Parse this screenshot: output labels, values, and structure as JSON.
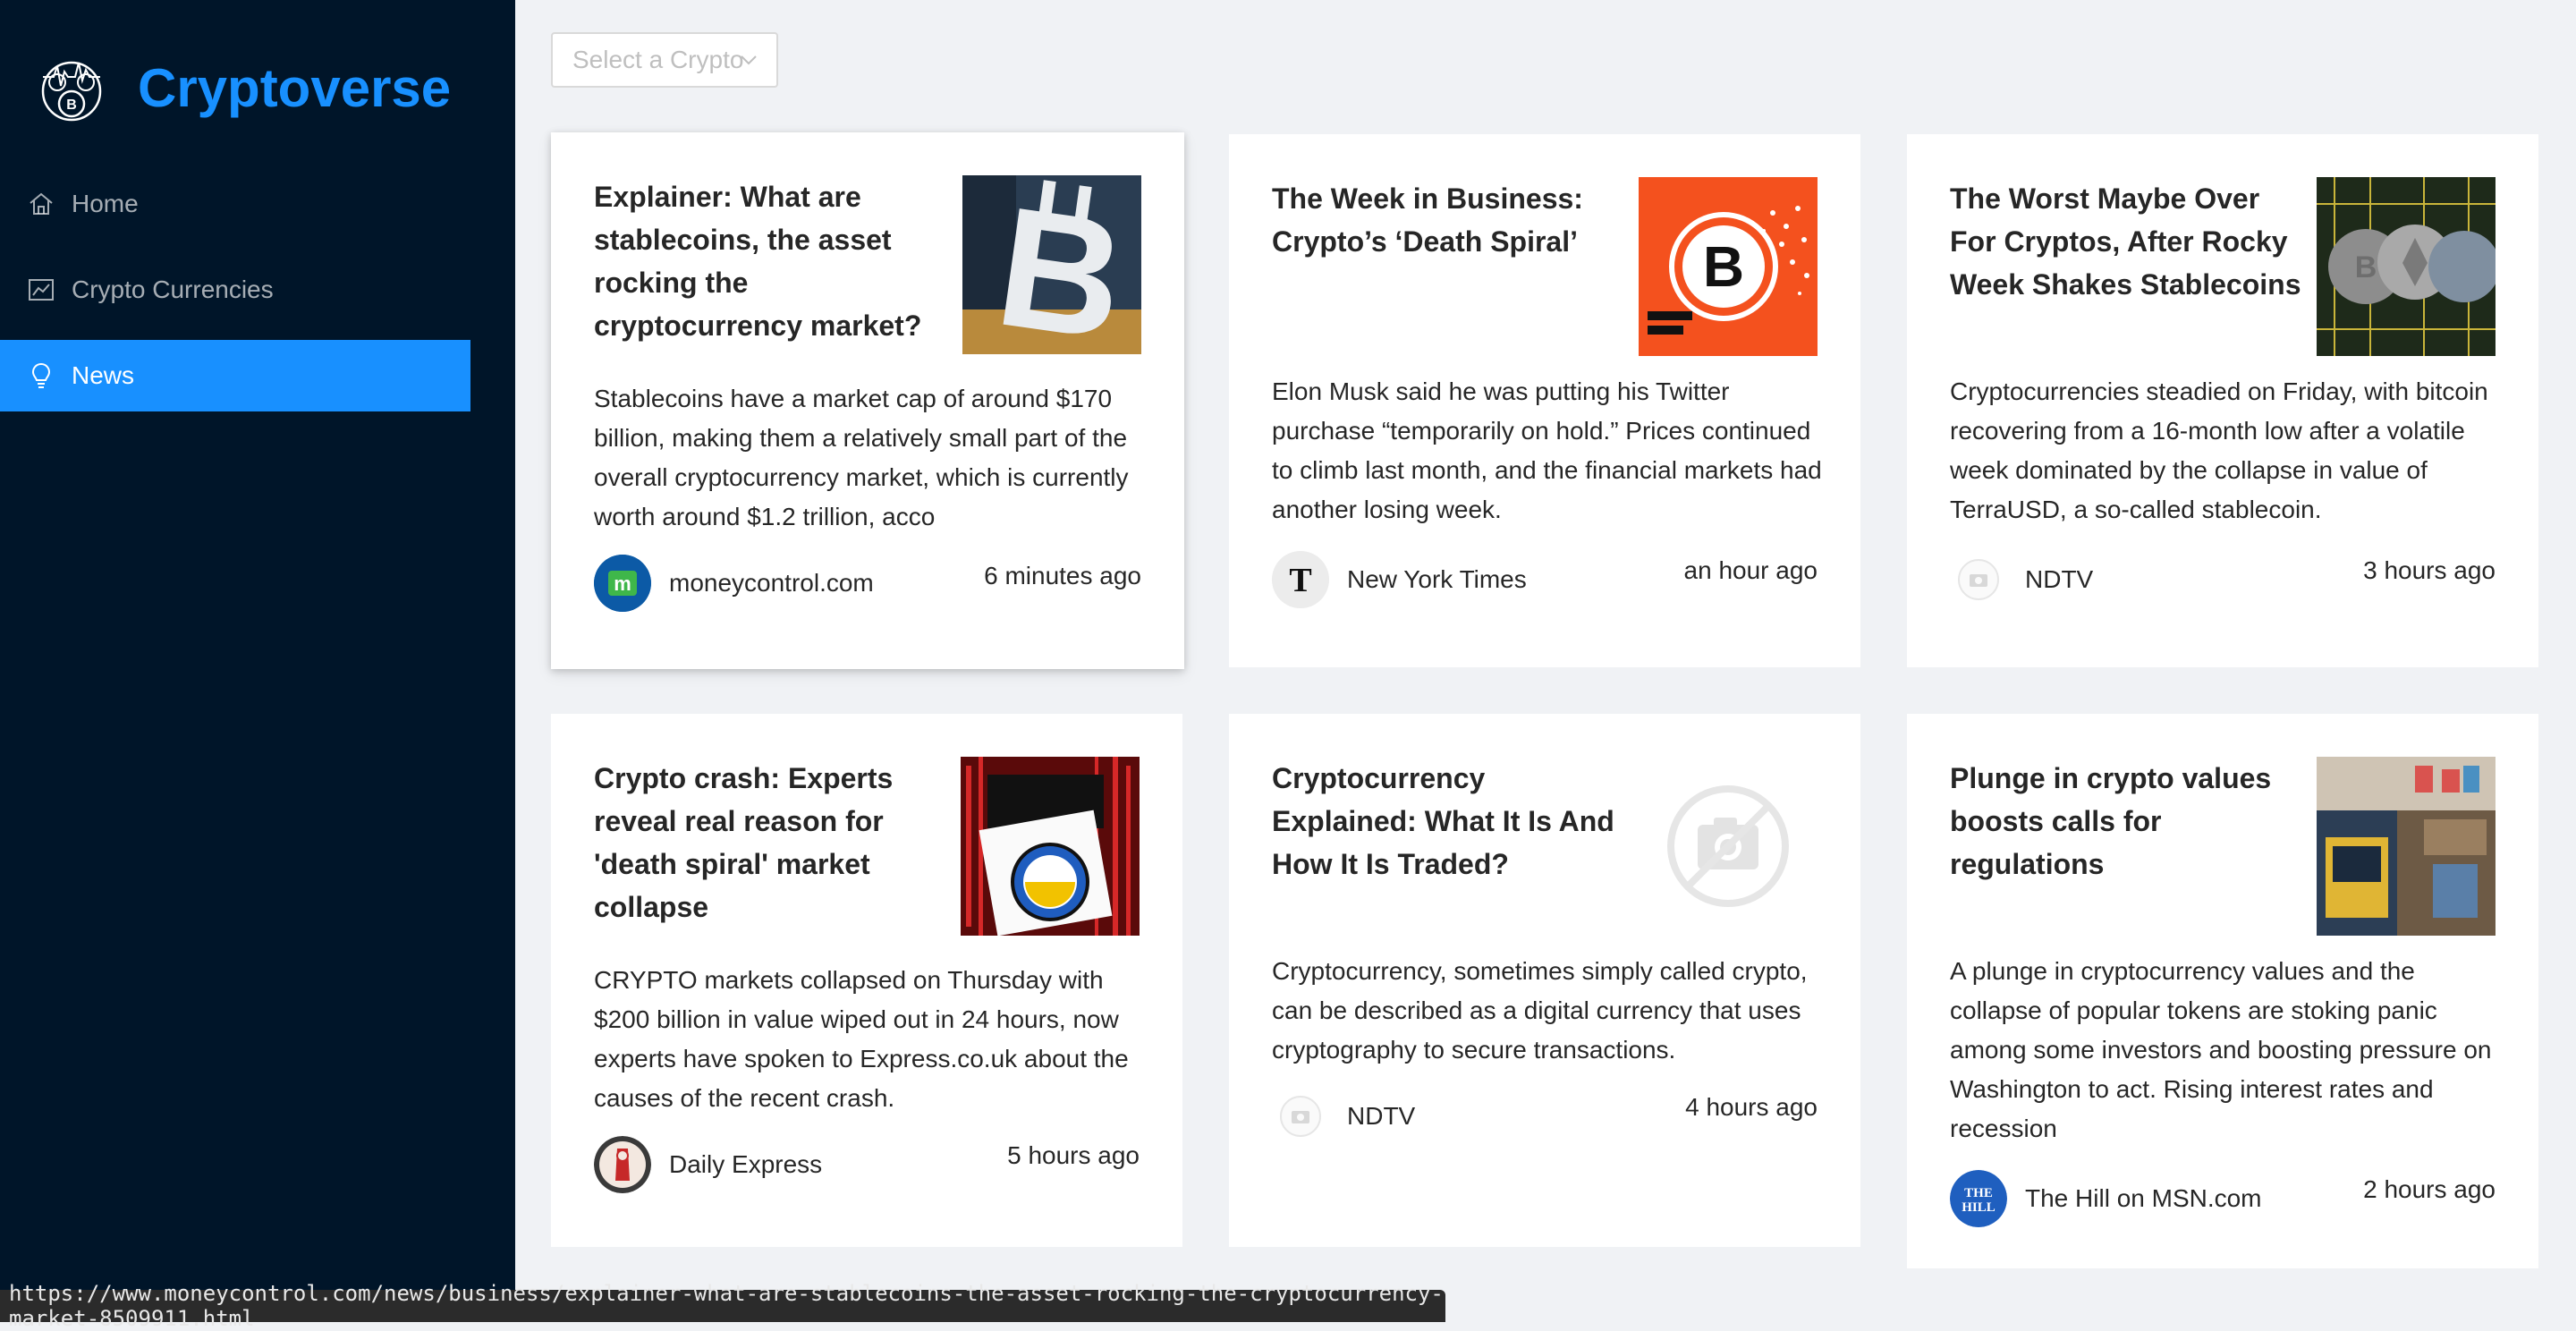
{
  "app": {
    "title": "Cryptoverse"
  },
  "sidebar": {
    "logo_icon": "bitcoin-logo-icon",
    "items": [
      {
        "label": "Home",
        "icon": "home-icon"
      },
      {
        "label": "Crypto Currencies",
        "icon": "line-chart-icon"
      },
      {
        "label": "News",
        "icon": "bulb-icon",
        "active": true
      }
    ]
  },
  "filter": {
    "placeholder": "Select a Crypto"
  },
  "news": [
    {
      "title": "Explainer: What are stablecoins, the asset rocking the cryptocurrency market?",
      "description": "Stablecoins have a market cap of around $170 billion, making them a relatively small part of the overall cryptocurrency market, which is currently worth around $1.2 trillion, acco",
      "provider": "moneycontrol.com",
      "time": "6 minutes ago"
    },
    {
      "title": "The Week in Business: Crypto’s ‘Death Spiral’",
      "description": "Elon Musk said he was putting his Twitter purchase “temporarily on hold.” Prices continued to climb last month, and the financial markets had another losing week.",
      "provider": "New York Times",
      "time": "an hour ago"
    },
    {
      "title": "The Worst Maybe Over For Cryptos, After Rocky Week Shakes Stablecoins",
      "description": "Cryptocurrencies steadied on Friday, with bitcoin recovering from a 16-month low after a volatile week dominated by the collapse in value of TerraUSD, a so-called stablecoin.",
      "provider": "NDTV",
      "time": "3 hours ago"
    },
    {
      "title": "Crypto crash: Experts reveal real reason for 'death spiral' market collapse",
      "description": "CRYPTO markets collapsed on Thursday with $200 billion in value wiped out in 24 hours, now experts have spoken to Express.co.uk about the causes of the recent crash.",
      "provider": "Daily Express",
      "time": "5 hours ago"
    },
    {
      "title": "Cryptocurrency Explained: What It Is And How It Is Traded?",
      "description": "Cryptocurrency, sometimes simply called crypto, can be described as a digital currency that uses cryptography to secure transactions.",
      "provider": "NDTV",
      "time": "4 hours ago"
    },
    {
      "title": "Plunge in crypto values boosts calls for regulations",
      "description": "A plunge in cryptocurrency values and the collapse of popular tokens are stoking panic among some investors and boosting pressure on Washington to act. Rising interest rates and recession",
      "provider": "The Hill on MSN.com",
      "time": "2 hours ago"
    }
  ],
  "statusbar": {
    "url": "https://www.moneycontrol.com/news/business/explainer-what-are-stablecoins-the-asset-rocking-the-cryptocurrency-market-8509911.html"
  },
  "colors": {
    "sidebar_bg": "#001529",
    "accent": "#1890ff",
    "page_bg": "#f0f2f5"
  }
}
